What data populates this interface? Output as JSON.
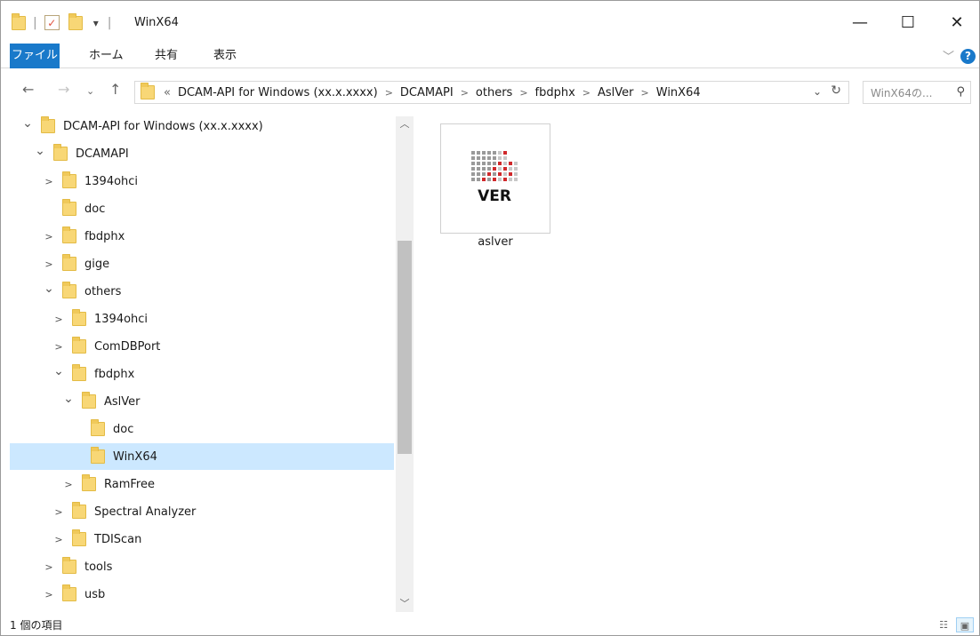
{
  "window": {
    "title": "WinX64"
  },
  "controls": {
    "minimize": "—",
    "maximize": "☐",
    "close": "✕"
  },
  "ribbon": {
    "tabs": [
      "ファイル",
      "ホーム",
      "共有",
      "表示"
    ]
  },
  "address": {
    "prefix": "«",
    "crumbs": [
      "DCAM-API for Windows (xx.x.xxxx)",
      "DCAMAPI",
      "others",
      "fbdphx",
      "AslVer",
      "WinX64"
    ]
  },
  "search": {
    "placeholder": "WinX64の..."
  },
  "tree": [
    {
      "label": "DCAM-API for Windows (xx.x.xxxx)",
      "expander": "expanded",
      "depth": 1
    },
    {
      "label": "DCAMAPI",
      "expander": "expanded",
      "depth": 2
    },
    {
      "label": "1394ohci",
      "expander": "collapsed",
      "depth": 3
    },
    {
      "label": "doc",
      "expander": "none",
      "depth": 3
    },
    {
      "label": "fbdphx",
      "expander": "collapsed",
      "depth": 3
    },
    {
      "label": "gige",
      "expander": "collapsed",
      "depth": 3
    },
    {
      "label": "others",
      "expander": "expanded",
      "depth": 3
    },
    {
      "label": "1394ohci",
      "expander": "collapsed",
      "depth": 4
    },
    {
      "label": "ComDBPort",
      "expander": "collapsed",
      "depth": 4
    },
    {
      "label": "fbdphx",
      "expander": "expanded",
      "depth": 4
    },
    {
      "label": "AslVer",
      "expander": "expanded",
      "depth": 5
    },
    {
      "label": "doc",
      "expander": "none",
      "depth": 6
    },
    {
      "label": "WinX64",
      "expander": "none",
      "depth": 6,
      "selected": true
    },
    {
      "label": "RamFree",
      "expander": "collapsed",
      "depth": 5
    },
    {
      "label": "Spectral Analyzer",
      "expander": "collapsed",
      "depth": 4
    },
    {
      "label": "TDIScan",
      "expander": "collapsed",
      "depth": 4
    },
    {
      "label": "tools",
      "expander": "collapsed",
      "depth": 3
    },
    {
      "label": "usb",
      "expander": "collapsed",
      "depth": 3
    }
  ],
  "files": [
    {
      "name": "aslver",
      "icon_text": "VER",
      "icon": "ver-app-icon"
    }
  ],
  "status": {
    "text": "1 個の項目"
  },
  "colors": {
    "accent": "#1979ca",
    "selection": "#cce8ff",
    "folder": "#f8d776",
    "ver_red": "#d0282b"
  }
}
